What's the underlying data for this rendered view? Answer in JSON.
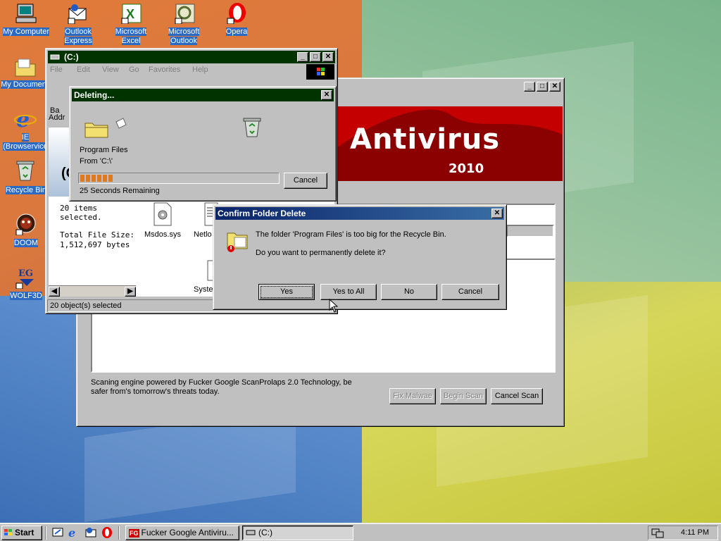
{
  "desktop": {
    "icons": [
      {
        "label": "My Computer",
        "icon": "computer-icon"
      },
      {
        "label": "Outlook Express",
        "icon": "outlook-express-icon"
      },
      {
        "label": "Microsoft Excel",
        "icon": "excel-icon"
      },
      {
        "label": "Microsoft Outlook",
        "icon": "outlook-icon"
      },
      {
        "label": "Opera",
        "icon": "opera-icon"
      },
      {
        "label": "My Document",
        "icon": "folder-icon"
      },
      {
        "label": "IE (Browservice",
        "icon": "ie-icon"
      },
      {
        "label": "Recycle Bin",
        "icon": "recycle-bin-icon"
      },
      {
        "label": "DOOM",
        "icon": "doom-icon"
      },
      {
        "label": "WOLF3D",
        "icon": "wolf3d-icon"
      }
    ]
  },
  "explorer": {
    "title": "(C:)",
    "menu": [
      "File",
      "Edit",
      "View",
      "Go",
      "Favorites",
      "Help"
    ],
    "toolbar_back": "Ba",
    "address_label": "Addr",
    "drive_heading": "(C",
    "selection_info": {
      "count": "20 items selected.",
      "size_label": "Total File Size:",
      "size_value": "1,512,697 bytes"
    },
    "files": [
      "Msdos.sys",
      "Netlo",
      "Syste"
    ],
    "status": "20 object(s) selected"
  },
  "antivirus": {
    "title": "",
    "banner_title": "Antivirus",
    "banner_year": "2010",
    "footer_text": "Scaning engine powered by Fucker Google ScanProlaps 2.0 Technology, be safer from's tomorrow's threats today.",
    "buttons": {
      "fix": "Fix Malwae",
      "begin": "Begin Scan",
      "cancel": "Cancel Scan"
    },
    "accent": "#8b0000"
  },
  "deleting": {
    "title": "Deleting...",
    "item": "Program Files",
    "from": "From 'C:\\'",
    "progress_fraction": 0.17,
    "remaining": "25 Seconds Remaining",
    "cancel": "Cancel"
  },
  "confirm": {
    "title": "Confirm Folder Delete",
    "line1": "The folder 'Program Files' is too big for the Recycle Bin.",
    "line2": "Do you want to permanently delete it?",
    "buttons": {
      "yes": "Yes",
      "yes_all": "Yes to All",
      "no": "No",
      "cancel": "Cancel"
    }
  },
  "taskbar": {
    "start": "Start",
    "tasks": [
      {
        "label": "Fucker Google Antiviru...",
        "icon": "FG"
      },
      {
        "label": "(C:)",
        "icon": "drive-icon"
      }
    ],
    "clock": "4:11 PM"
  }
}
